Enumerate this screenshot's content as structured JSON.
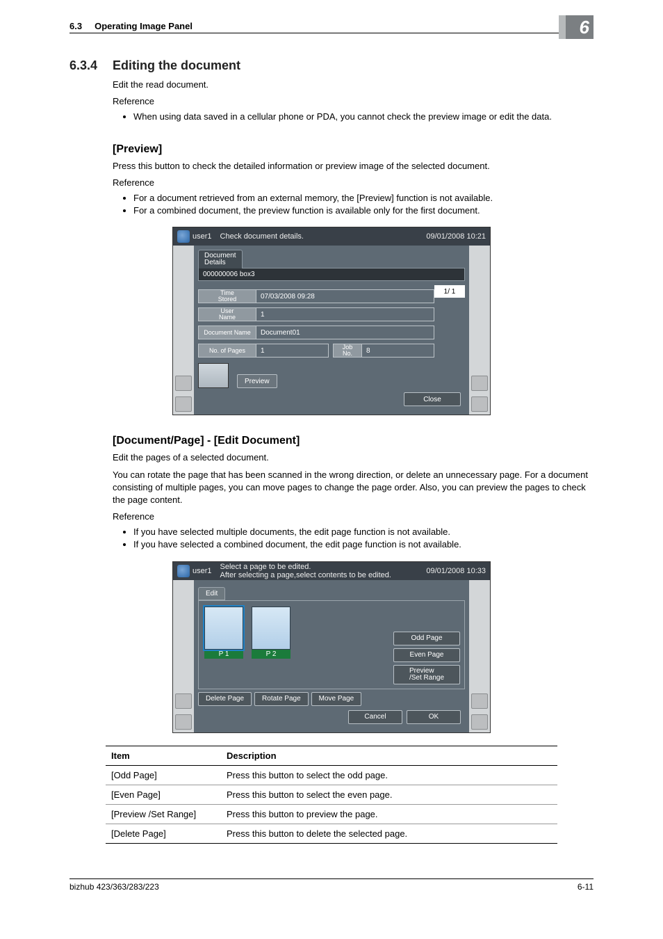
{
  "header": {
    "section_num": "6.3",
    "section_title": "Operating Image Panel",
    "chapter": "6"
  },
  "s634": {
    "num": "6.3.4",
    "title": "Editing the document",
    "p1": "Edit the read document.",
    "ref": "Reference",
    "b1": "When using data saved in a cellular phone or PDA, you cannot check the preview image or edit the data."
  },
  "preview": {
    "title": "[Preview]",
    "p1": "Press this button to check the detailed information or preview image of the selected document.",
    "ref": "Reference",
    "b1": "For a document retrieved from an external memory, the [Preview] function is not available.",
    "b2": "For a combined document, the preview function is available only for the first document."
  },
  "panel1": {
    "user": "user1",
    "msg": "Check document details.",
    "datetime": "09/01/2008  10:21",
    "tab": "Document\nDetails",
    "bar": "000000006 box3",
    "time_lbl": "Time\nStored",
    "time_val": "07/03/2008 09:28",
    "user_lbl": "User\nName",
    "user_val": "1",
    "doc_lbl": "Document Name",
    "doc_val": "Document01",
    "pages_lbl": "No. of Pages",
    "pages_val": "1",
    "job_lbl": "Job\nNo.",
    "job_val": "8",
    "page_ind": "1/  1",
    "preview_btn": "Preview",
    "close_btn": "Close"
  },
  "docpage": {
    "title": "[Document/Page] - [Edit Document]",
    "p1": "Edit the pages of a selected document.",
    "p2": "You can rotate the page that has been scanned in the wrong direction, or delete an unnecessary page. For a document consisting of multiple pages, you can move pages to change the page order. Also, you can preview the pages to check the page content.",
    "ref": "Reference",
    "b1": "If you have selected multiple documents, the edit page function is not available.",
    "b2": "If you have selected a combined document, the edit page function is not available."
  },
  "panel2": {
    "user": "user1",
    "msg1": "Select a page to be edited.",
    "msg2": "After selecting a page,select contents to be edited.",
    "datetime": "09/01/2008  10:33",
    "tab": "Edit",
    "p1": "P   1",
    "p2": "P   2",
    "odd": "Odd Page",
    "even": "Even Page",
    "prev": "Preview\n/Set Range",
    "del": "Delete Page",
    "rot": "Rotate Page",
    "mov": "Move Page",
    "cancel": "Cancel",
    "ok": "OK"
  },
  "table": {
    "h1": "Item",
    "h2": "Description",
    "rows": [
      {
        "item": "[Odd Page]",
        "desc": "Press this button to select the odd page."
      },
      {
        "item": "[Even Page]",
        "desc": "Press this button to select the even page."
      },
      {
        "item": "[Preview /Set Range]",
        "desc": "Press this button to preview the page."
      },
      {
        "item": "[Delete Page]",
        "desc": "Press this button to delete the selected page."
      }
    ]
  },
  "footer": {
    "model": "bizhub 423/363/283/223",
    "page": "6-11"
  }
}
